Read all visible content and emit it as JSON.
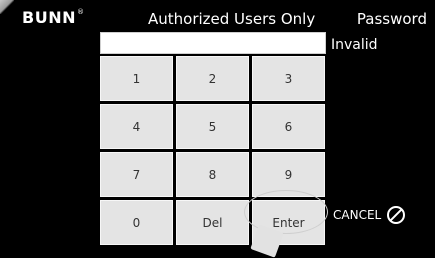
{
  "header": {
    "brand": "BUNN",
    "brand_mark": "®",
    "title": "Authorized Users Only",
    "password_label": "Password"
  },
  "password": {
    "value": "",
    "status": "Invalid"
  },
  "keypad": {
    "keys": [
      "1",
      "2",
      "3",
      "4",
      "5",
      "6",
      "7",
      "8",
      "9",
      "0",
      "Del",
      "Enter"
    ]
  },
  "cancel": {
    "label": "CANCEL",
    "icon": "cancel-icon"
  }
}
